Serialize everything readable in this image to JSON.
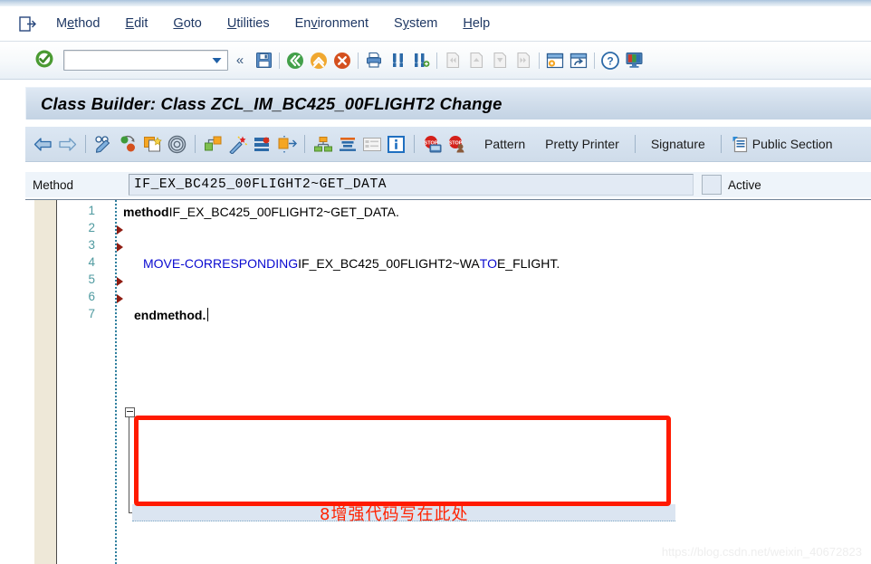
{
  "window": {
    "title": "Class Builder: Class ZCL_IM_BC425_00FLIGHT2 Change"
  },
  "menubar": {
    "system_icon": "exit-session-icon",
    "items": [
      {
        "name": "method",
        "pre": "M",
        "u": "e",
        "post": "thod"
      },
      {
        "name": "edit",
        "pre": "",
        "u": "E",
        "post": "dit"
      },
      {
        "name": "goto",
        "pre": "",
        "u": "G",
        "post": "oto"
      },
      {
        "name": "utilities",
        "pre": "",
        "u": "U",
        "post": "tilities"
      },
      {
        "name": "environment",
        "pre": "En",
        "u": "v",
        "post": "ironment"
      },
      {
        "name": "system",
        "pre": "S",
        "u": "y",
        "post": "stem"
      },
      {
        "name": "help",
        "pre": "",
        "u": "H",
        "post": "elp"
      }
    ]
  },
  "standard_toolbar": {
    "ok_button": "enter-ok-icon",
    "command_field": {
      "value": "",
      "placeholder": ""
    },
    "collapse_label": "«",
    "icons": [
      "save-icon",
      "back-icon",
      "exit-icon",
      "cancel-icon",
      "print-icon",
      "find-icon",
      "find-next-icon",
      "first-page-icon",
      "previous-page-icon",
      "next-page-icon",
      "last-page-icon",
      "create-session-icon",
      "create-shortcut-icon",
      "help-icon",
      "customize-local-layout-icon"
    ]
  },
  "application_toolbar": {
    "icons": [
      "back-arrow-icon",
      "forward-arrow-icon",
      "display-change-icon",
      "check-icon",
      "copy-icon",
      "pattern-spiral-icon",
      "activate-icon",
      "magic-wand-icon",
      "where-used-icon",
      "expand-icon",
      "hierarchy-icon",
      "stack-icon",
      "table-icon",
      "info-icon",
      "breakpoint-icon",
      "breakpoint-user-icon"
    ],
    "buttons": [
      {
        "name": "pattern-button",
        "label": "Pattern"
      },
      {
        "name": "pretty-printer-button",
        "label": "Pretty Printer"
      },
      {
        "name": "signature-button",
        "label": "Signature"
      },
      {
        "name": "public-section-button",
        "label": "Public Section",
        "icon": "document-section-icon"
      }
    ]
  },
  "method_row": {
    "label": "Method",
    "value": "IF_EX_BC425_00FLIGHT2~GET_DATA",
    "status": "Active"
  },
  "editor": {
    "line_numbers": [
      "1",
      "2",
      "3",
      "4",
      "5",
      "6",
      "7"
    ],
    "marker_lines": [
      2,
      3,
      5,
      6
    ],
    "lines": [
      {
        "n": 1,
        "segments": [
          {
            "text": "method ",
            "style": "bold"
          },
          {
            "text": "IF_EX_BC425_00FLIGHT2~GET_DATA.",
            "style": "plain"
          }
        ]
      },
      {
        "n": 2,
        "segments": []
      },
      {
        "n": 3,
        "segments": []
      },
      {
        "n": 4,
        "segments": [
          {
            "text": "MOVE-CORRESPONDING ",
            "style": "kw"
          },
          {
            "text": "IF_EX_BC425_00FLIGHT2~WA ",
            "style": "plain"
          },
          {
            "text": "TO ",
            "style": "kw"
          },
          {
            "text": " E_FLIGHT.",
            "style": "plain"
          }
        ]
      },
      {
        "n": 5,
        "segments": []
      },
      {
        "n": 6,
        "segments": []
      },
      {
        "n": 7,
        "segments": [
          {
            "text": "endmethod.",
            "style": "bold"
          }
        ]
      }
    ]
  },
  "annotation": {
    "text": "8增强代码写在此处",
    "color": "#ff2200",
    "box_color": "#ff1a00"
  },
  "watermark": {
    "text": "https://blog.csdn.net/weixin_40672823"
  }
}
